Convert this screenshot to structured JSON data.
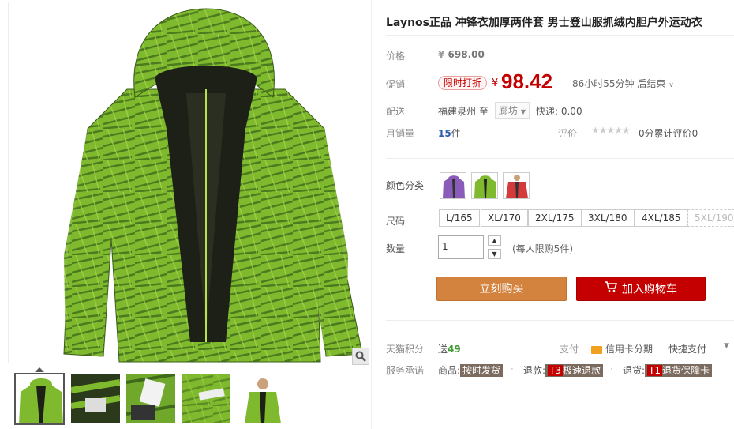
{
  "product": {
    "title": "Laynos正品 冲锋衣加厚两件套 男士登山服抓绒内胆户外运动衣"
  },
  "price": {
    "label": "价格",
    "currency": "¥",
    "original": "698.00"
  },
  "promo": {
    "label": "促销",
    "badge": "限时打折",
    "currency": "¥",
    "price": "98.42",
    "countdown": "86小时55分钟 后结束"
  },
  "shipping": {
    "label": "配送",
    "from": "福建泉州",
    "to_word": "至",
    "destination": "廊坊",
    "fee": "快递: 0.00"
  },
  "sales": {
    "label": "月销量",
    "count": "15",
    "unit": "件",
    "rating_label": "评价",
    "rating_text": "0分累计评价0"
  },
  "color": {
    "label": "颜色分类",
    "options": [
      "purple",
      "green",
      "red"
    ]
  },
  "size": {
    "label": "尺码",
    "options": [
      "L/165",
      "XL/170",
      "2XL/175",
      "3XL/180",
      "4XL/185",
      "5XL/190"
    ]
  },
  "quantity": {
    "label": "数量",
    "value": "1",
    "limit": "(每人限购5件)"
  },
  "buttons": {
    "buy": "立刻购买",
    "cart": "加入购物车"
  },
  "points": {
    "label": "天猫积分",
    "prefix": "送",
    "value": "49"
  },
  "payment": {
    "label": "支付",
    "credit": "信用卡分期",
    "quick": "快捷支付"
  },
  "service": {
    "label": "服务承诺",
    "items": [
      {
        "prefix": "商品:",
        "tag": "按时发货"
      },
      {
        "prefix": "退款:",
        "code": "T3",
        "tag": "极速退款"
      },
      {
        "prefix": "退货:",
        "code": "T1",
        "tag": "退货保障卡"
      }
    ]
  },
  "colors": {
    "accent": "#c40000",
    "buy_button": "#d4833e",
    "jacket_green": "#7ab62c"
  }
}
